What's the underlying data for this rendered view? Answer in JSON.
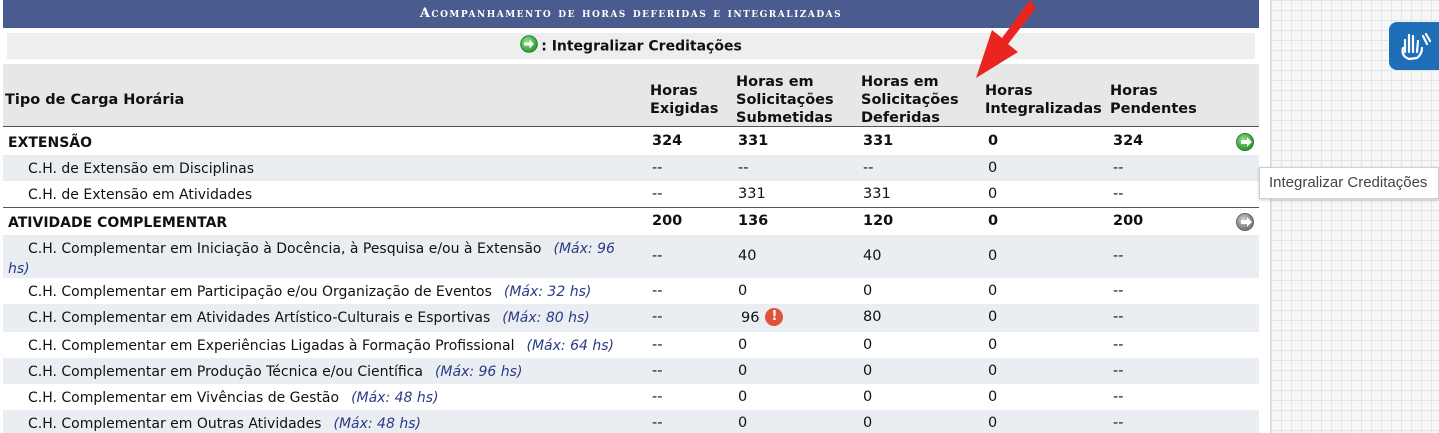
{
  "title": "Acompanhamento de horas deferidas e integralizadas",
  "legend": {
    "text": ": Integralizar Creditações",
    "icon": "go-arrow-icon"
  },
  "columns": {
    "tipo": "Tipo de Carga Horária",
    "exigidas": [
      "Horas",
      "Exigidas"
    ],
    "submetidas": [
      "Horas em",
      "Solicitações",
      "Submetidas"
    ],
    "deferidas": [
      "Horas em",
      "Solicitações",
      "Deferidas"
    ],
    "integralizadas": [
      "Horas",
      "Integralizadas"
    ],
    "pendentes": [
      "Horas",
      "Pendentes"
    ]
  },
  "groups": [
    {
      "name": "EXTENSÃO",
      "exigidas": "324",
      "submetidas": "331",
      "deferidas": "331",
      "integralizadas": "0",
      "pendentes": "324",
      "action": "Integralizar Creditações",
      "rows": [
        {
          "label": "C.H. de Extensão em Disciplinas",
          "max": "",
          "exigidas": "--",
          "submetidas": "--",
          "deferidas": "--",
          "integralizadas": "0",
          "pendentes": "--"
        },
        {
          "label": "C.H. de Extensão em Atividades",
          "max": "",
          "exigidas": "--",
          "submetidas": "331",
          "deferidas": "331",
          "integralizadas": "0",
          "pendentes": "--"
        }
      ]
    },
    {
      "name": "ATIVIDADE COMPLEMENTAR",
      "exigidas": "200",
      "submetidas": "136",
      "deferidas": "120",
      "integralizadas": "0",
      "pendentes": "200",
      "rows": [
        {
          "label": "C.H. Complementar em Iniciação à Docência, à Pesquisa e/ou à Extensão",
          "max": "(Máx: 96 hs)",
          "exigidas": "--",
          "submetidas": "40",
          "deferidas": "40",
          "integralizadas": "0",
          "pendentes": "--"
        },
        {
          "label": "C.H. Complementar em Participação e/ou Organização de Eventos",
          "max": "(Máx: 32 hs)",
          "exigidas": "--",
          "submetidas": "0",
          "deferidas": "0",
          "integralizadas": "0",
          "pendentes": "--"
        },
        {
          "label": "C.H. Complementar em Atividades Artístico-Culturais e Esportivas",
          "max": "(Máx: 80 hs)",
          "exigidas": "--",
          "submetidas": "96",
          "deferidas": "80",
          "integralizadas": "0",
          "pendentes": "--",
          "warning": "!"
        },
        {
          "label": "C.H. Complementar em Experiências Ligadas à Formação Profissional",
          "max": "(Máx: 64 hs)",
          "exigidas": "--",
          "submetidas": "0",
          "deferidas": "0",
          "integralizadas": "0",
          "pendentes": "--"
        },
        {
          "label": "C.H. Complementar em Produção Técnica e/ou Científica",
          "max": "(Máx: 96 hs)",
          "exigidas": "--",
          "submetidas": "0",
          "deferidas": "0",
          "integralizadas": "0",
          "pendentes": "--"
        },
        {
          "label": "C.H. Complementar em Vivências de Gestão",
          "max": "(Máx: 48 hs)",
          "exigidas": "--",
          "submetidas": "0",
          "deferidas": "0",
          "integralizadas": "0",
          "pendentes": "--"
        },
        {
          "label": "C.H. Complementar em Outras Atividades",
          "max": "(Máx: 48 hs)",
          "exigidas": "--",
          "submetidas": "0",
          "deferidas": "0",
          "integralizadas": "0",
          "pendentes": "--"
        }
      ]
    }
  ],
  "tooltip": "Integralizar Creditações",
  "accessibility": {
    "icon": "sign-language-hands-icon"
  },
  "colors": {
    "title_bar": "#4a5c8f",
    "max_text": "#2b3a86",
    "arrow": "#e8261f",
    "shade_row": "#eaeef2",
    "access_button": "#1e6fb8"
  }
}
